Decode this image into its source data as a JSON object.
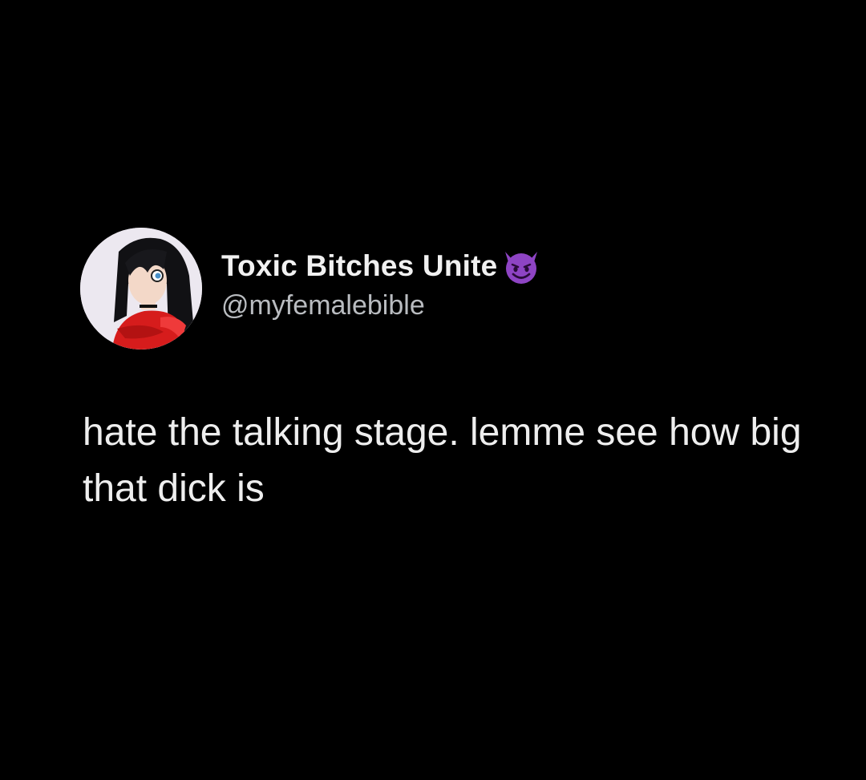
{
  "tweet": {
    "author": {
      "display_name": "Toxic Bitches Unite",
      "handle": "@myfemalebible",
      "name_emoji": "smiling-devil-icon",
      "avatar": "cartoon-girl-avatar"
    },
    "text": "hate the talking stage. lemme see how big that dick is"
  },
  "colors": {
    "background": "#000000",
    "name": "#f1f1f1",
    "handle": "#b9bcc0",
    "body": "#eeeeee",
    "emoji": "#8e44c4"
  }
}
